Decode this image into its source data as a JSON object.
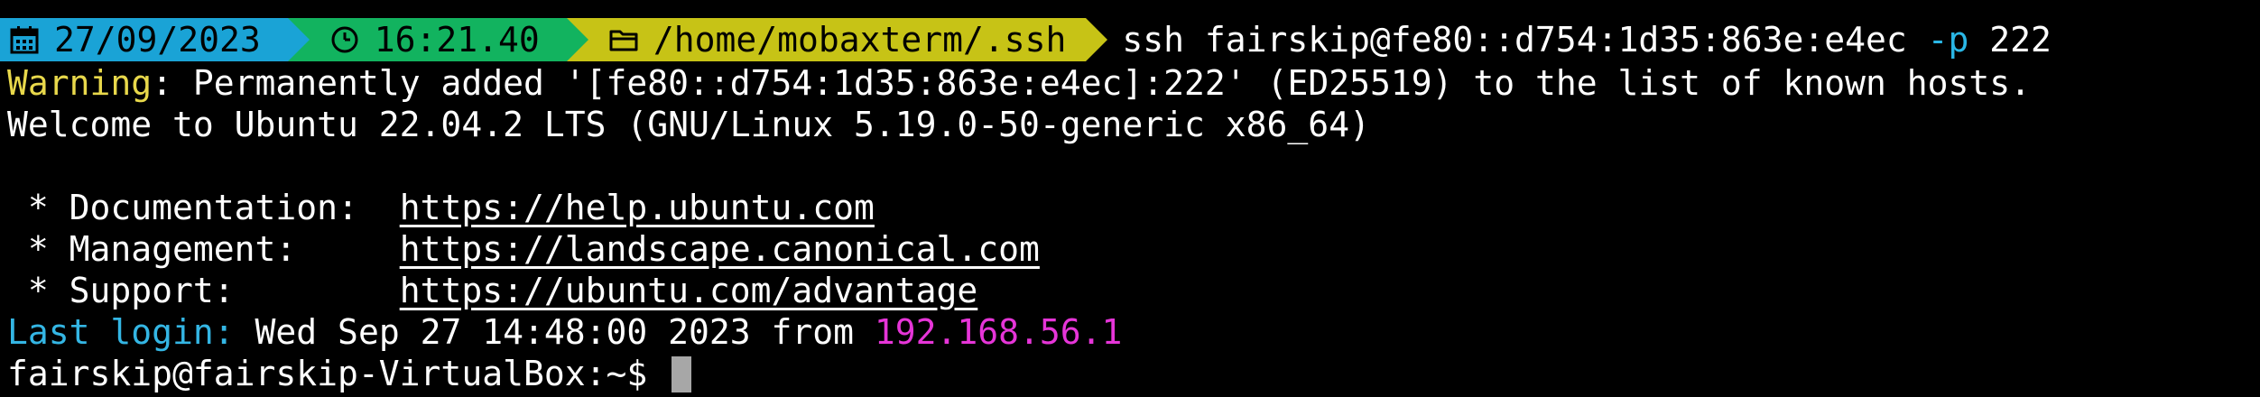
{
  "prompt": {
    "date": "27/09/2023",
    "time": "16:21.40",
    "path": "/home/mobaxterm/.ssh",
    "command_text": "ssh fairskip@fe80::d754:1d35:863e:e4ec",
    "command_flag": "-p",
    "command_arg": "222",
    "icons": [
      "calendar-icon",
      "clock-icon",
      "folder-icon"
    ],
    "colors": {
      "date_segment": "#1aa3d6",
      "time_segment": "#12b35f",
      "path_segment": "#c7c316"
    }
  },
  "output": {
    "warning_label": "Warning",
    "warning_text": ": Permanently added '[fe80::d754:1d35:863e:e4ec]:222' (ED25519) to the list of known hosts.",
    "welcome": "Welcome to Ubuntu 22.04.2 LTS (GNU/Linux 5.19.0-50-generic x86_64)",
    "links": [
      {
        "label": " * Documentation:  ",
        "url": "https://help.ubuntu.com"
      },
      {
        "label": " * Management:     ",
        "url": "https://landscape.canonical.com"
      },
      {
        "label": " * Support:        ",
        "url": "https://ubuntu.com/advantage"
      }
    ],
    "last_login_label": "Last login:",
    "last_login_text": " Wed Sep 27 14:48:00 2023 from ",
    "last_login_ip": "192.168.56.1",
    "shell_prompt": "fairskip@fairskip-VirtualBox:~$ "
  }
}
